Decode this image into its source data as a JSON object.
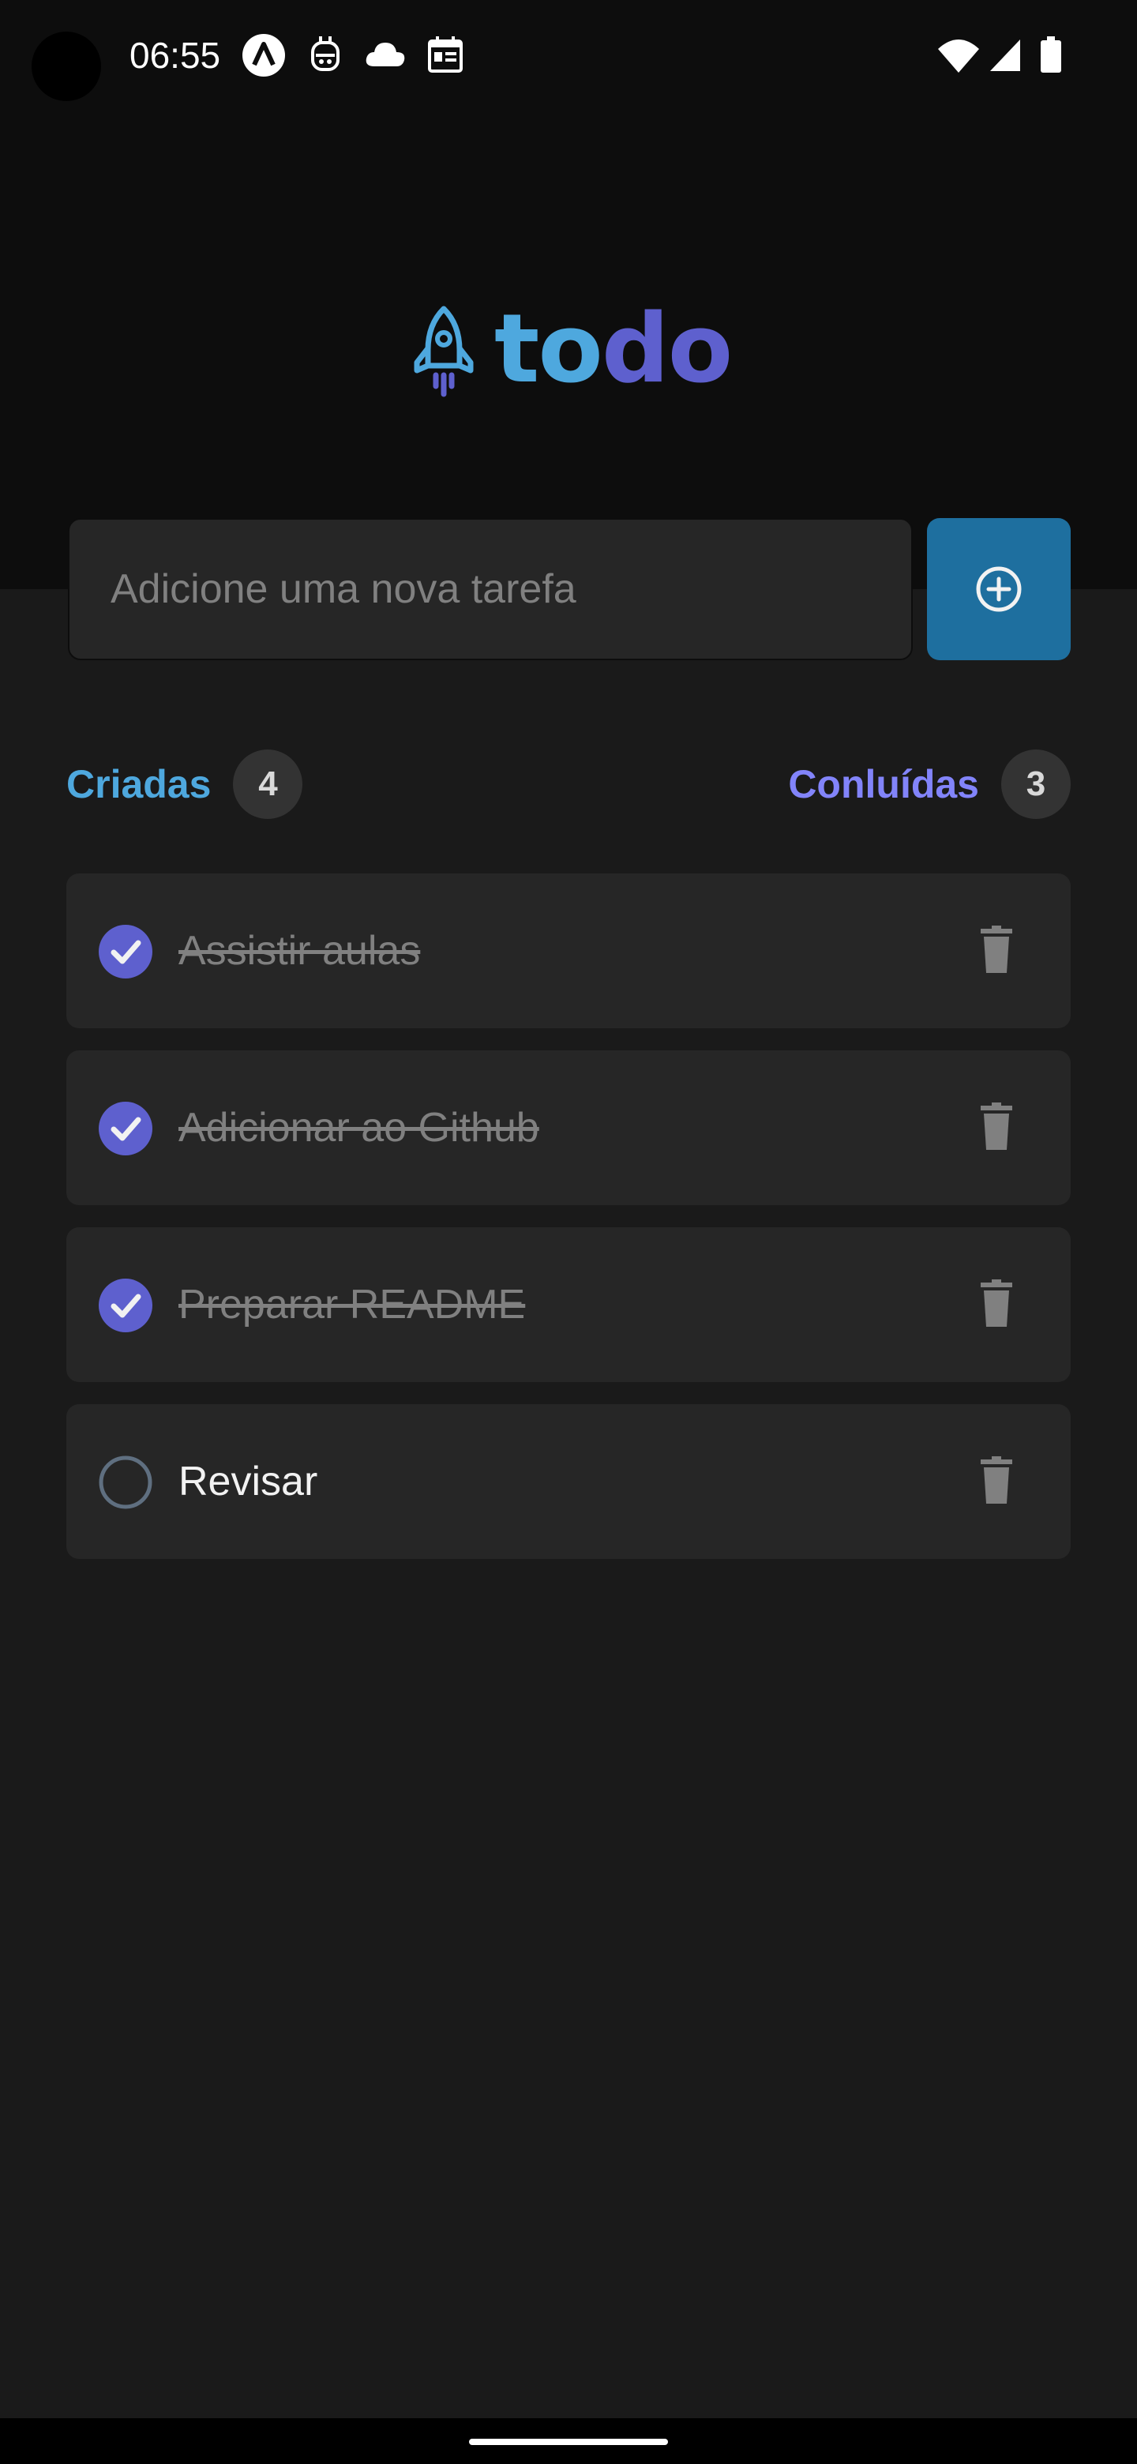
{
  "status_bar": {
    "time": "06:55",
    "icons": [
      "app-a-icon",
      "robot-icon",
      "cloud-icon",
      "calendar-icon",
      "wifi-icon",
      "signal-icon",
      "battery-icon"
    ]
  },
  "logo": {
    "icon": "rocket-icon",
    "text_part1": "to",
    "text_part2": "do"
  },
  "input": {
    "value": "",
    "placeholder": "Adicione uma nova tarefa"
  },
  "add_button": {
    "icon": "plus-circle-icon"
  },
  "counters": {
    "created_label": "Criadas",
    "created_count": "4",
    "done_label": "Conluídas",
    "done_count": "3"
  },
  "tasks": [
    {
      "text": "Assistir aulas",
      "done": true
    },
    {
      "text": "Adicionar ao Github",
      "done": true
    },
    {
      "text": "Preparar README",
      "done": true
    },
    {
      "text": "Revisar",
      "done": false
    }
  ],
  "colors": {
    "blue": "#4ea8de",
    "blue_dark": "#1e6f9f",
    "purple": "#5e60ce",
    "purple_light": "#8284fa",
    "background": "#1a1a1a",
    "header_background": "#0d0d0d",
    "card": "#262626"
  }
}
